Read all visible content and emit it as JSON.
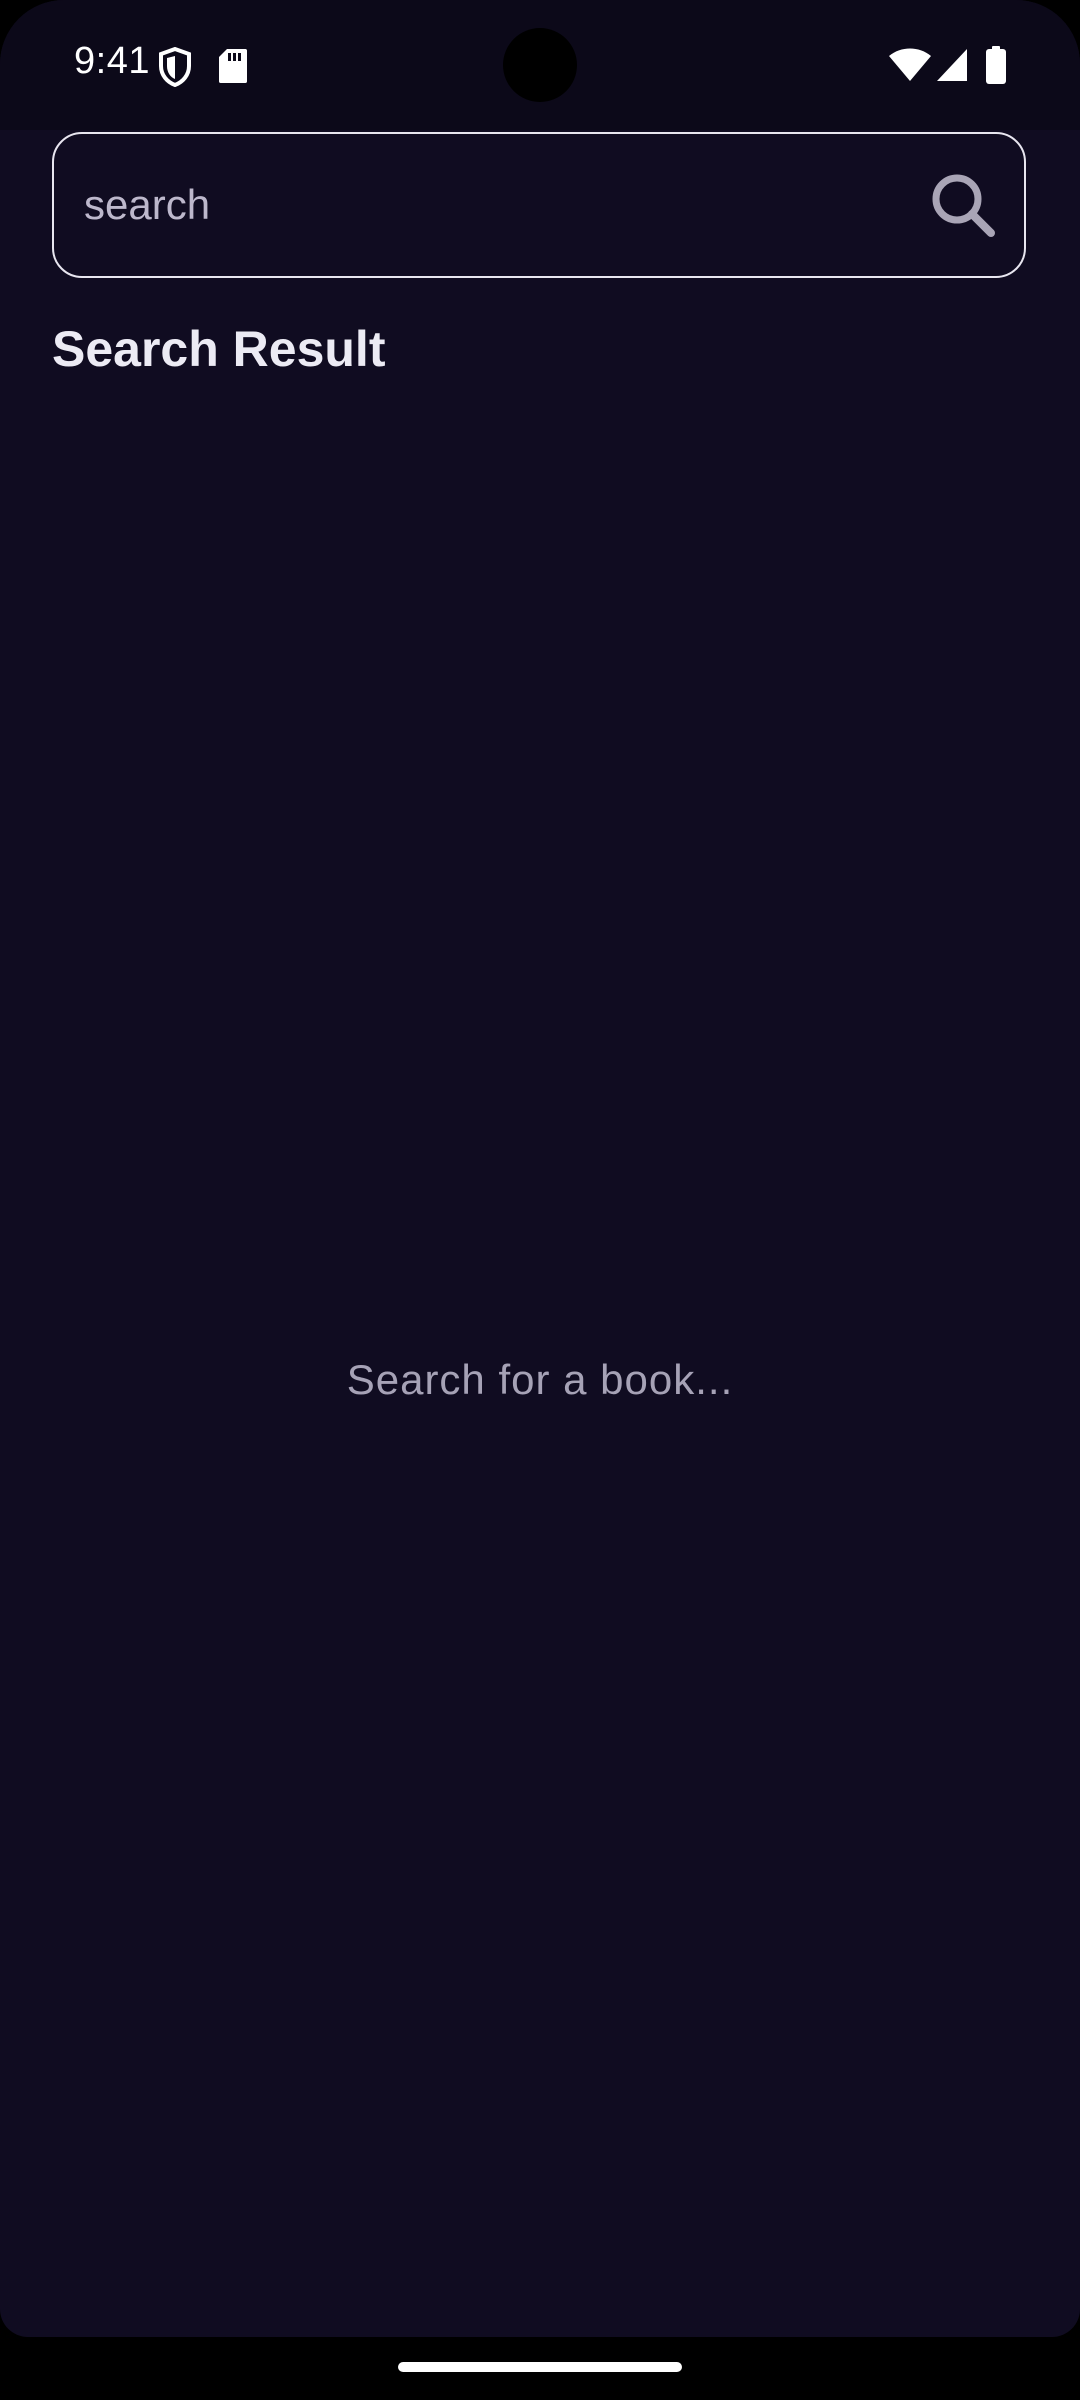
{
  "status_bar": {
    "time": "9:41",
    "icons": [
      "shield-icon",
      "sd-card-icon",
      "wifi-icon",
      "signal-icon",
      "battery-icon"
    ]
  },
  "search": {
    "placeholder": "search",
    "value": "",
    "icon": "search-icon"
  },
  "results": {
    "title": "Search Result",
    "empty_message": "Search for a book..."
  },
  "colors": {
    "background": "#100c21",
    "status_bar": "#0c0919",
    "text_primary": "#ecebf4",
    "text_muted": "#a6a2b6",
    "border": "#e8e6f0"
  }
}
